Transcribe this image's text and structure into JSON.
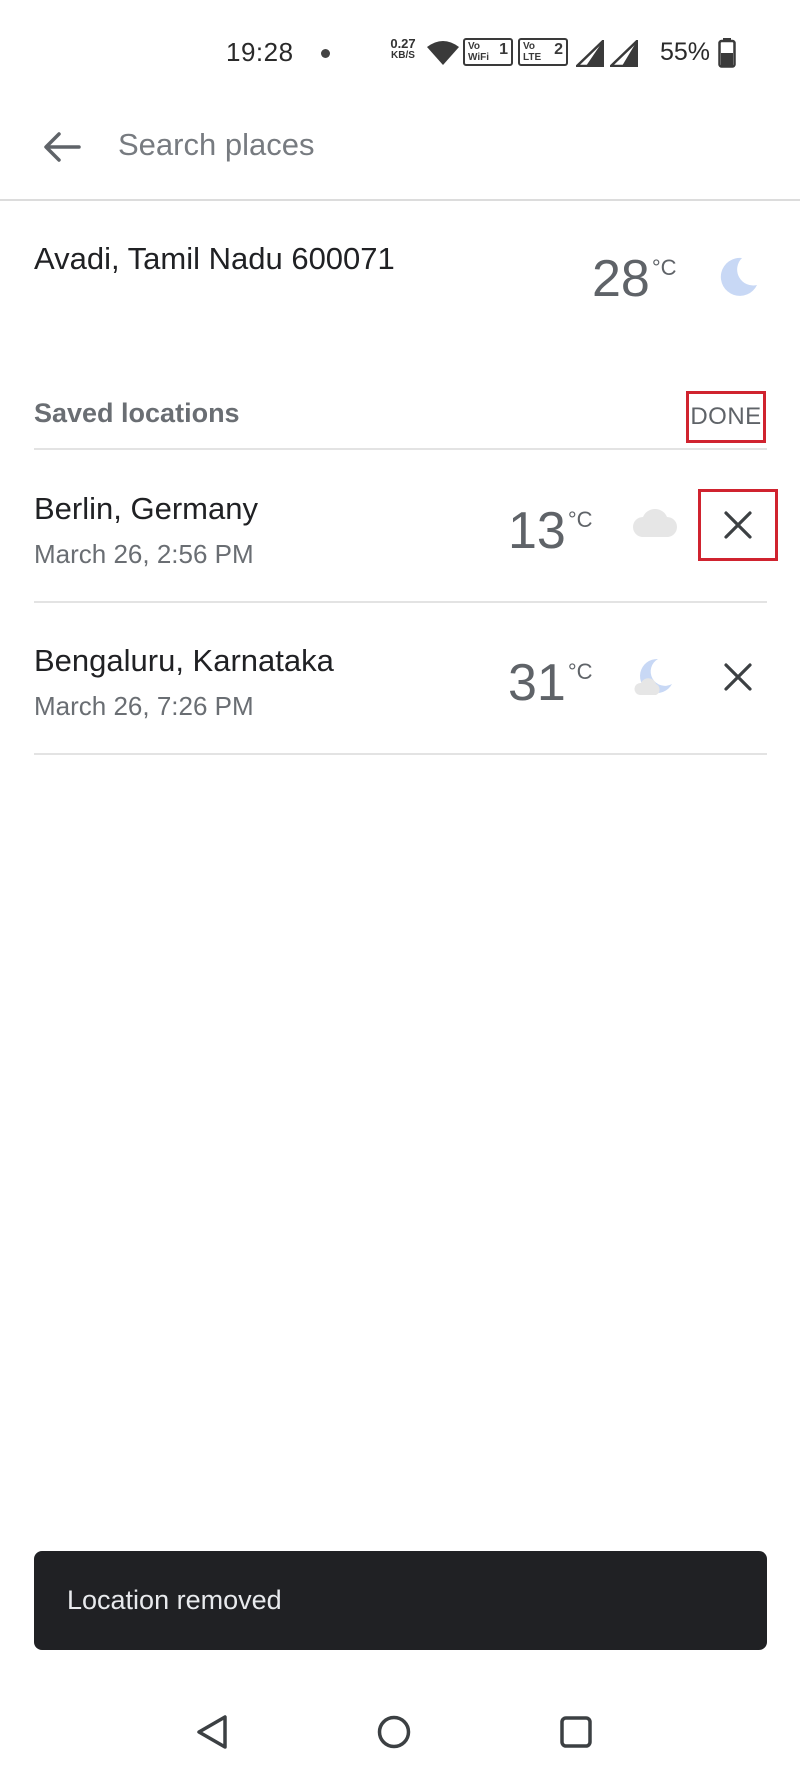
{
  "status_bar": {
    "time": "19:28",
    "net_speed_value": "0.27",
    "net_speed_unit": "KB/S",
    "vowifi_top": "Vo",
    "vowifi_bottom": "WiFi",
    "vowifi_sim": "1",
    "volte_top": "Vo",
    "volte_bottom": "LTE",
    "volte_sim": "2",
    "battery": "55%"
  },
  "search": {
    "placeholder": "Search places"
  },
  "current_location": {
    "name": "Avadi, Tamil Nadu 600071",
    "temperature": "28",
    "unit": "°C",
    "condition_icon": "moon-icon"
  },
  "saved": {
    "title": "Saved locations",
    "done_label": "DONE",
    "locations": [
      {
        "name": "Berlin, Germany",
        "time": "March 26, 2:56 PM",
        "temperature": "13",
        "unit": "°C",
        "condition_icon": "cloud-icon"
      },
      {
        "name": "Bengaluru, Karnataka",
        "time": "March 26, 7:26 PM",
        "temperature": "31",
        "unit": "°C",
        "condition_icon": "moon-cloud-icon"
      }
    ]
  },
  "snackbar": {
    "message": "Location removed"
  },
  "colors": {
    "highlight_box": "#d0232f",
    "moon": "#c8d8f5",
    "cloud": "#e6e6e6",
    "snackbar_bg": "#202124"
  }
}
